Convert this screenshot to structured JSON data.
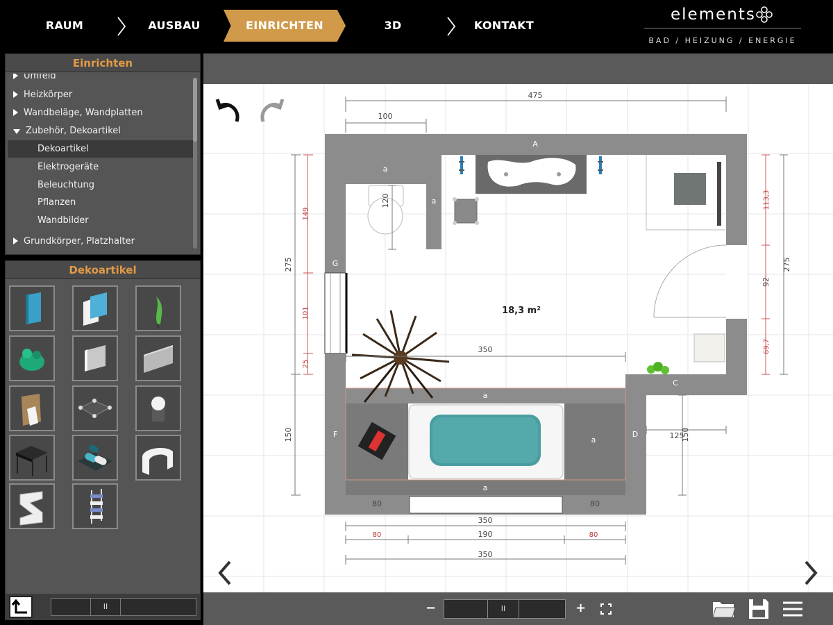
{
  "nav": {
    "steps": [
      {
        "label": "RAUM"
      },
      {
        "label": "AUSBAU"
      },
      {
        "label": "EINRICHTEN",
        "active": true
      },
      {
        "label": "3D"
      },
      {
        "label": "KONTAKT"
      }
    ],
    "brand_name": "elements",
    "brand_tagline": "BAD / HEIZUNG / ENERGIE"
  },
  "category_panel": {
    "title": "Einrichten",
    "items": [
      {
        "label": "Umfeld",
        "indent": 0,
        "partial": true
      },
      {
        "label": "Heizkörper",
        "indent": 0,
        "expandable": true
      },
      {
        "label": "Wandbeläge, Wandplatten",
        "indent": 0,
        "expandable": true
      },
      {
        "label": "Zubehör, Dekoartikel",
        "indent": 0,
        "expanded": true
      },
      {
        "label": "Dekoartikel",
        "indent": 1,
        "selected": true
      },
      {
        "label": "Elektrogeräte",
        "indent": 1
      },
      {
        "label": "Beleuchtung",
        "indent": 1
      },
      {
        "label": "Pflanzen",
        "indent": 1
      },
      {
        "label": "Wandbilder",
        "indent": 1
      },
      {
        "label": "Grundkörper, Platzhalter",
        "indent": 0,
        "expandable": true
      }
    ]
  },
  "items_panel": {
    "title": "Dekoartikel",
    "tiles": [
      {
        "icon": "blue-panel-icon"
      },
      {
        "icon": "white-blue-box-icon"
      },
      {
        "icon": "green-plant-icon"
      },
      {
        "icon": "green-frog-icon"
      },
      {
        "icon": "grey-panel-icon"
      },
      {
        "icon": "grey-wall-panel-icon"
      },
      {
        "icon": "tissue-box-icon"
      },
      {
        "icon": "round-table-icon"
      },
      {
        "icon": "cylinder-lamp-icon"
      },
      {
        "icon": "black-stool-icon"
      },
      {
        "icon": "towels-icon"
      },
      {
        "icon": "white-arch-icon"
      },
      {
        "icon": "z-stand-icon"
      },
      {
        "icon": "towel-ladder-icon"
      }
    ],
    "pager_mid": "II"
  },
  "floorplan": {
    "area_label": "18,3 m²",
    "dims": {
      "top_total": "475",
      "top_inner": "100",
      "left_total": "275",
      "right_total": "275",
      "right_upper": "113,3",
      "right_door": "92",
      "right_lower": "69,7",
      "left_upper": "149",
      "left_mid": "101",
      "left_lower": "25",
      "wc_depth": "120",
      "inner_width": "350",
      "bottom_height": "150",
      "right_notch": "150",
      "right_notch_w": "125",
      "bottom_a": "350",
      "bottom_b": "350",
      "bottom_left": "80",
      "bottom_mid": "190",
      "bottom_right": "80",
      "bottom_in_left": "80",
      "bottom_in_right": "80"
    },
    "wall_labels": [
      "A",
      "a",
      "a",
      "G",
      "C",
      "a",
      "F",
      "a",
      "D",
      "a"
    ]
  },
  "bottombar": {
    "zoom_minus": "−",
    "zoom_plus": "+",
    "pager_mid": "II"
  },
  "colors": {
    "accent": "#d19a4a",
    "panel_title": "#e19a45",
    "wall": "#8a8a8a"
  }
}
